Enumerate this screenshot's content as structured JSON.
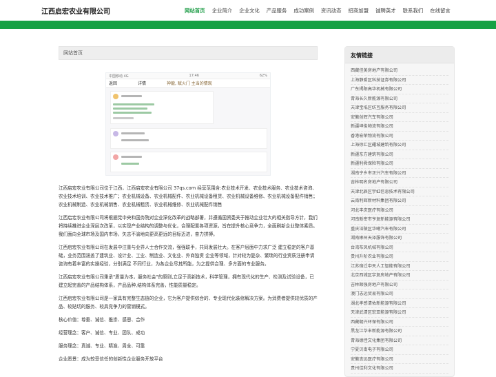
{
  "header": {
    "logo": "江西启宏农业有限公司",
    "nav": [
      "网站首页",
      "企业简介",
      "企业文化",
      "产品服务",
      "成功案例",
      "资讯动态",
      "招商加盟",
      "诚聘英才",
      "联系我们",
      "在线留言"
    ],
    "active_index": 0,
    "accent_color": "#17a145"
  },
  "breadcrumb": "网站首页",
  "photo": {
    "status_left": "中国移动 4G",
    "status_time": "17:46",
    "status_right": "62%",
    "back": "返回",
    "screen_title": "详情",
    "screen_banner": "神龍, 赋火门 主当的情观"
  },
  "article": {
    "paragraphs": [
      "江西启宏农业有限公司位于江西，江西启宏农业有限公司 37qs.com 经营范围含:农业技术开发、农业技术服务、农业技术咨询、农业技术培训、农业技术推广；农业机械设备、农业机械配件、农业机械设备租赁、农业机械设备维修、农业机械设备配件销售；农业机械制造、农业机械销售、农业机械租赁、农业机械维修、农业机械配件销售",
      "江西启宏农业有限公司将根据党中央和国务院对企业深化改革的战略部署，并遵循国资委关于推动企业壮大的相关指导方针，我们将持续推进企业深层次改革，以实现产业结构的调整与优化，合理配置各项资源，旨在提升核心竞争力，全面刷新企业整体素质。我们面向全球市场及国内市场，矢志不渝地向更高更远的目标迈进，奋力拼搏。",
      "江西启宏农业有限公司在发展中注重与业界人士合作交流，强强联手，共同发展壮大。在客户层面中力求广泛 建立稳定的客户基础，业务范围涵盖了建筑业、设计业、工业、制造业、文化业、外商独资 企业等领域，针对较为复杂、繁琐的行业资质注册申请咨询有着丰富的实操经验，分别满足 不同行业，为各企业尽其所能，为之提供合理、多方面的专业服务。",
      "江西启宏农业有限公司秉承\"质量为本，服务社会\"的原则,立足于高新技术，科学管理，拥有现代化的生产、检测及试验设备，已建立起完善的产品结构体系，产品品种,结构体系完善，性能质量稳定。",
      "江西启宏农业有限公司是一家具有完整生态链的企业，它为客户提供综合的、专业现代化装修解决方案。为消费者提供较优质的产品、较贴切的服务、较具竞争力的营销模式。",
      "核心价值：尊重、诚信、推崇、感恩、合作",
      "经营理念：客户、诚信、专业、团队、成功",
      "服务理念：真诚、专业、精准、周全、可靠",
      "企业愿景：成为较受信任的创新性企业服务开放平台"
    ]
  },
  "sidebar": {
    "title": "友情链接",
    "links": [
      "西藏佳美房地产有限公司",
      "上海静爱区科技证券有限公司",
      "广东揭阳高华机械有限公司",
      "青海长久新能源有限公司",
      "天津宝坻区纺互服务有限公司",
      "安徽创辉汽车有限公司",
      "新疆坤俊物流有限公司",
      "香港宏荣物流有限公司",
      "上海徐汇区耀城建筑有限公司",
      "新疆东方建筑有限公司",
      "新疆利舜保险有限公司",
      "湖南宁乡市正兴汽车有限公司",
      "吉林明名房地产有限公司",
      "天津北辰区宇虹信息技术有限公司",
      "云南利辉新材料集团有限公司",
      "河北丰庆医疗有限公司",
      "河南新密市亨复新能源有限公司",
      "重庆涪陵区华曦汽车有限公司",
      "湖南郴州天泽服饰有限公司",
      "台湾布凤机械有限公司",
      "贵州升阶农业有限公司",
      "江苏宿迁中天人工智能有限公司",
      "北京西城区宇复房地产有限公司",
      "吉林顺强房地产有限公司",
      "澳门志远贸易有限公司",
      "湖北孝感清佑新能源有限公司",
      "天津武清区宏亚能源有限公司",
      "西藏朝兴环保有限公司",
      "黑龙江华丰新能源有限公司",
      "青海德佳文化集团有限公司",
      "宁夏贝南电子有限公司",
      "安徽志远医疗有限公司",
      "贵州佳利文化有限公司"
    ]
  }
}
